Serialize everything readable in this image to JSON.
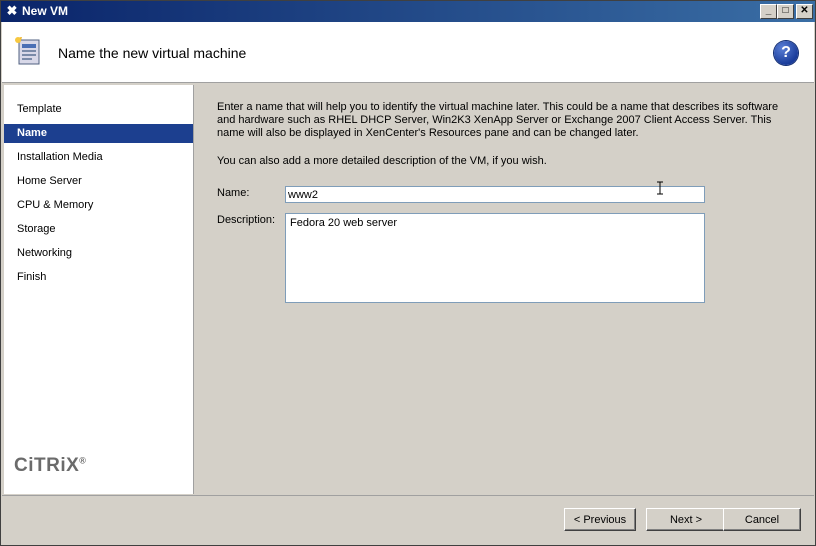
{
  "window": {
    "title": "New VM",
    "minimize_label": "_",
    "maximize_label": "□",
    "close_label": "✕"
  },
  "header": {
    "title": "Name the new virtual machine",
    "help_label": "?"
  },
  "sidebar": {
    "items": [
      {
        "label": "Template",
        "active": false
      },
      {
        "label": "Name",
        "active": true
      },
      {
        "label": "Installation Media",
        "active": false
      },
      {
        "label": "Home Server",
        "active": false
      },
      {
        "label": "CPU & Memory",
        "active": false
      },
      {
        "label": "Storage",
        "active": false
      },
      {
        "label": "Networking",
        "active": false
      },
      {
        "label": "Finish",
        "active": false
      }
    ],
    "logo": "CiTRiX",
    "logo_mark": "®"
  },
  "main": {
    "intro": "Enter a name that will help you to identify the virtual machine later. This could be a name that describes its software and hardware such as RHEL DHCP Server, Win2K3 XenApp Server or Exchange 2007 Client Access Server. This name will also be displayed in XenCenter's Resources pane and can be changed later.",
    "intro2": "You can also add a more detailed description of the VM, if you wish.",
    "name_label": "Name:",
    "name_value": "www2",
    "description_label": "Description:",
    "description_value": "Fedora 20 web server"
  },
  "footer": {
    "previous_label": "< Previous",
    "next_label": "Next >",
    "cancel_label": "Cancel"
  },
  "colors": {
    "title_bar": "#0a246a",
    "active_nav": "#1c3f8f",
    "help_icon": "#1a3c9a"
  }
}
